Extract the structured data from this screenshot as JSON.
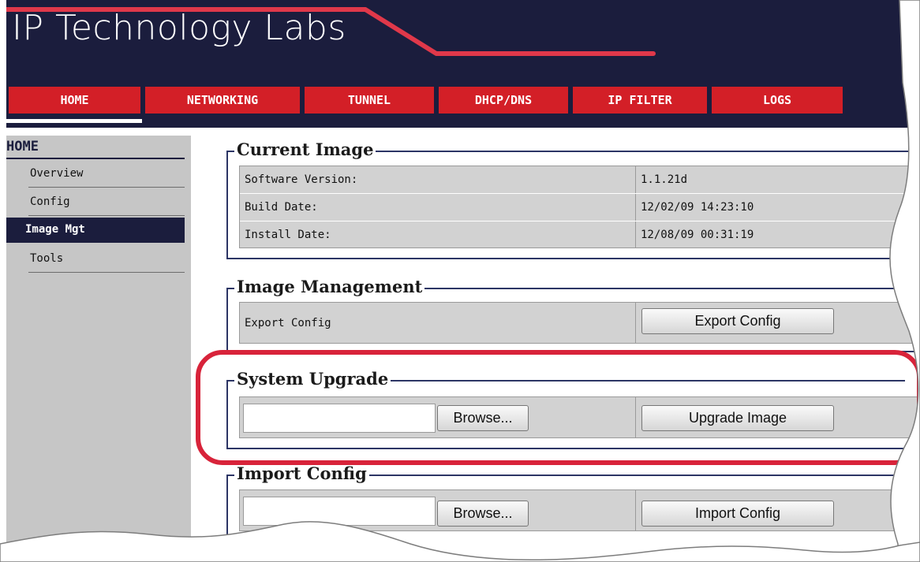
{
  "header": {
    "brand": "IP Technology Labs"
  },
  "nav": {
    "tabs": [
      {
        "label": "HOME"
      },
      {
        "label": "NETWORKING"
      },
      {
        "label": "TUNNEL"
      },
      {
        "label": "DHCP/DNS"
      },
      {
        "label": "IP FILTER"
      },
      {
        "label": "LOGS"
      }
    ],
    "active": "HOME"
  },
  "sidebar": {
    "heading": "HOME",
    "items": [
      {
        "label": "Overview"
      },
      {
        "label": "Config"
      },
      {
        "label": "Image Mgt"
      },
      {
        "label": "Tools"
      }
    ],
    "active": "Image Mgt"
  },
  "current_image": {
    "title": "Current Image",
    "rows": [
      {
        "label": "Software Version:",
        "value": "1.1.21d"
      },
      {
        "label": "Build Date:",
        "value": "12/02/09 14:23:10"
      },
      {
        "label": "Install Date:",
        "value": "12/08/09 00:31:19"
      }
    ]
  },
  "image_management": {
    "title": "Image Management",
    "row_label": "Export Config",
    "button": "Export Config"
  },
  "system_upgrade": {
    "title": "System Upgrade",
    "file_value": "",
    "browse": "Browse...",
    "button": "Upgrade Image"
  },
  "import_config": {
    "title": "Import Config",
    "file_value": "",
    "browse": "Browse...",
    "button": "Import Config"
  },
  "colors": {
    "header_navy": "#1b1d3d",
    "nav_red": "#d31f27",
    "highlight_red": "#d8233a",
    "sidebar_gray": "#c6c6c6",
    "table_gray": "#d2d2d2"
  }
}
